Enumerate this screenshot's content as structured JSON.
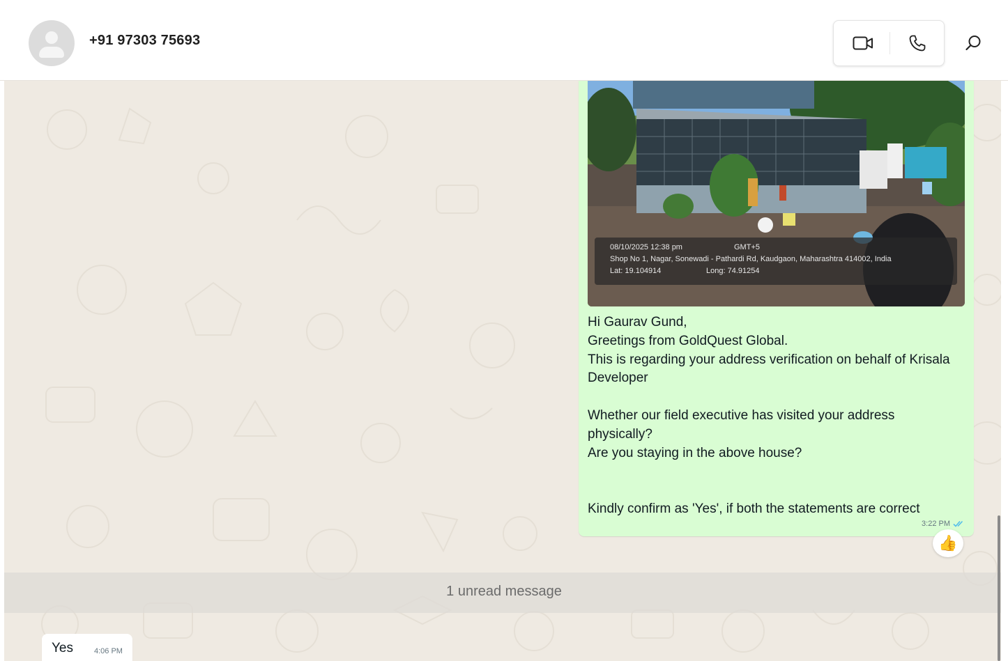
{
  "header": {
    "contact_name": "+91 97303 75693",
    "icons": [
      "avatar-placeholder-icon",
      "video-camera-icon",
      "phone-icon",
      "search-icon"
    ]
  },
  "outgoing_message": {
    "photo_stamp": {
      "datetime": "08/10/2025 12:38 pm",
      "timezone": "GMT+5",
      "address": "Shop No 1, Nagar, Sonewadi - Pathardi Rd, Kaudgaon, Maharashtra 414002, India",
      "lat": "Lat: 19.104914",
      "long": "Long: 74.91254"
    },
    "text": "Hi Gaurav Gund,\nGreetings from GoldQuest Global.\nThis is regarding your address verification on behalf of Krisala Developer\n\nWhether our field executive has visited your address physically?\nAre you staying in the above house?\n\n\nKindly confirm as 'Yes', if both the statements are correct",
    "time": "3:22 PM",
    "status": "read",
    "reaction": "👍"
  },
  "unread_divider": "1 unread message",
  "incoming_message": {
    "text": "Yes",
    "time": "4:06 PM"
  },
  "colors": {
    "chat_background": "#efeae2",
    "outgoing_bubble": "#d9fdd3",
    "incoming_bubble": "#ffffff",
    "read_ticks": "#53bdeb"
  }
}
